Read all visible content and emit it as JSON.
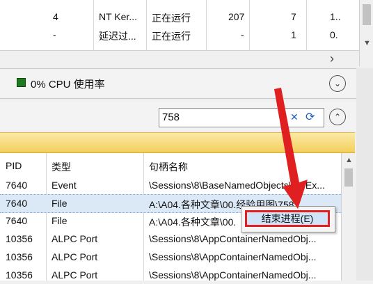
{
  "process_table": {
    "rows": [
      {
        "col1": "4",
        "name": "NT Ker...",
        "status": "正在运行",
        "count": "207",
        "num": "7",
        "extra": "1.."
      },
      {
        "col1": "-",
        "name": "延迟过...",
        "status": "正在运行",
        "count": "-",
        "num": "1",
        "extra": "0."
      }
    ],
    "scroll_arrow_right": "›"
  },
  "cpu_section": {
    "label": "0% CPU 使用率",
    "expand_glyph": "⌄"
  },
  "search": {
    "value": "758",
    "clear_glyph": "✕",
    "refresh_glyph": "⟳",
    "collapse_glyph": "⌃"
  },
  "handle_table": {
    "headers": [
      "PID",
      "类型",
      "句柄名称"
    ],
    "rows": [
      {
        "pid": "7640",
        "type": "Event",
        "name": "\\Sessions\\8\\BaseNamedObjects\\SGEx..."
      },
      {
        "pid": "7640",
        "type": "File",
        "name": "A:\\A04.各种文章\\00.经验用图\\758"
      },
      {
        "pid": "7640",
        "type": "File",
        "name": "A:\\A04.各种文章\\00."
      },
      {
        "pid": "10356",
        "type": "ALPC Port",
        "name": "\\Sessions\\8\\AppContainerNamedObj..."
      },
      {
        "pid": "10356",
        "type": "ALPC Port",
        "name": "\\Sessions\\8\\AppContainerNamedObj..."
      },
      {
        "pid": "10356",
        "type": "ALPC Port",
        "name": "\\Sessions\\8\\AppContainerNamedObj..."
      }
    ]
  },
  "context_menu": {
    "item": "结束进程(E)"
  },
  "colors": {
    "highlight_red": "#e02020",
    "selection_blue": "#cfe4f9",
    "band_yellow": "#f4cf5c"
  }
}
